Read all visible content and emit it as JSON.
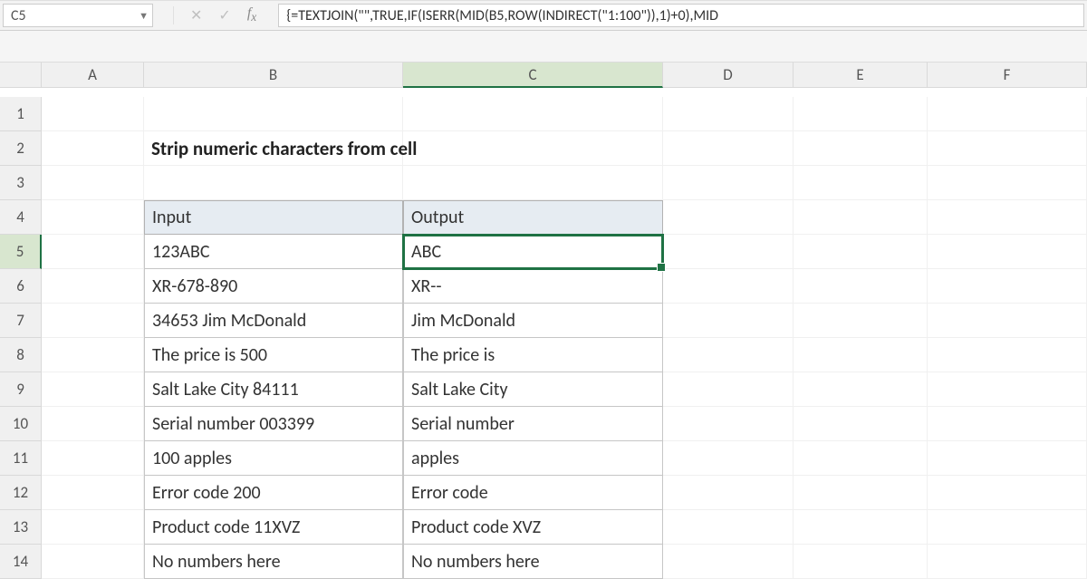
{
  "name_box": {
    "value": "C5"
  },
  "formula_bar": {
    "text": "{=TEXTJOIN(\"\",TRUE,IF(ISERR(MID(B5,ROW(INDIRECT(\"1:100\")),1)+0),MID"
  },
  "columns": [
    "A",
    "B",
    "C",
    "D",
    "E",
    "F"
  ],
  "rows": [
    "1",
    "2",
    "3",
    "4",
    "5",
    "6",
    "7",
    "8",
    "9",
    "10",
    "11",
    "12",
    "13",
    "14"
  ],
  "title": "Strip numeric characters from cell",
  "headers": {
    "input": "Input",
    "output": "Output"
  },
  "table": [
    {
      "input": "123ABC",
      "output": "ABC"
    },
    {
      "input": "XR-678-890",
      "output": "XR--"
    },
    {
      "input": "34653 Jim McDonald",
      "output": " Jim McDonald"
    },
    {
      "input": "The price is 500",
      "output": "The price is "
    },
    {
      "input": "Salt Lake City 84111",
      "output": "Salt Lake City "
    },
    {
      "input": "Serial number 003399",
      "output": "Serial number "
    },
    {
      "input": "100 apples",
      "output": " apples"
    },
    {
      "input": "Error code 200",
      "output": "Error code "
    },
    {
      "input": "Product code 11XVZ",
      "output": "Product code XVZ"
    },
    {
      "input": "No numbers here",
      "output": "No numbers here"
    }
  ],
  "active_cell": "C5"
}
